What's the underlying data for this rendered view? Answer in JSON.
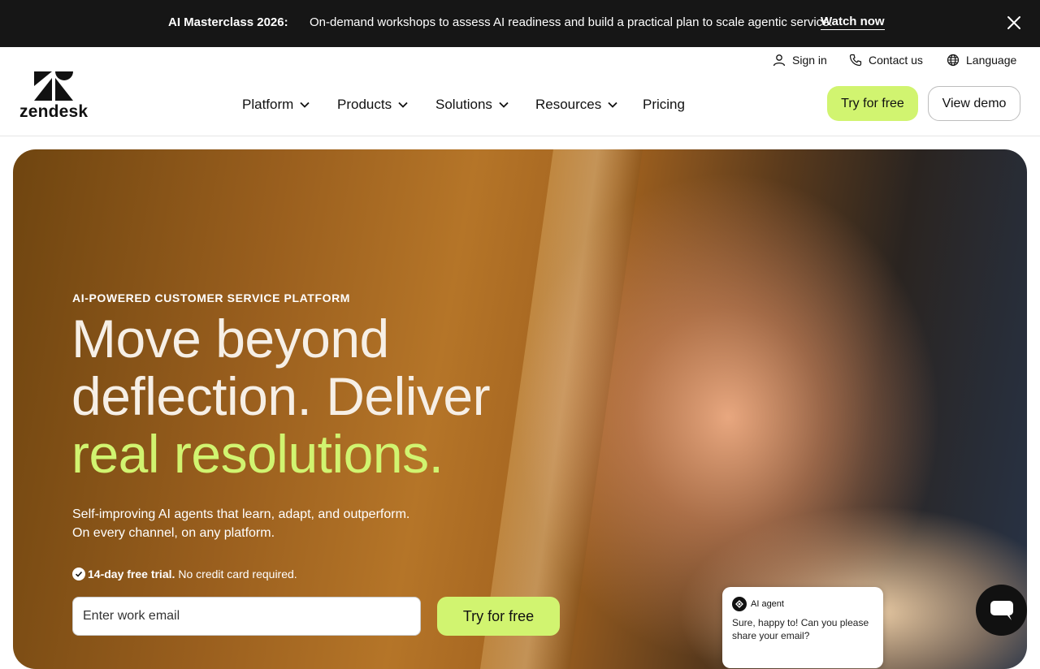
{
  "promo": {
    "title": "AI Masterclass 2026:",
    "text": "On-demand workshops to assess AI readiness and build a practical plan to scale agentic service.",
    "link": "Watch now"
  },
  "header": {
    "logo_text": "zendesk",
    "utility": {
      "sign_in": "Sign in",
      "contact": "Contact us",
      "language": "Language"
    },
    "nav": [
      "Platform",
      "Products",
      "Solutions",
      "Resources",
      "Pricing"
    ],
    "try_free": "Try for free",
    "view_demo": "View demo"
  },
  "hero": {
    "eyebrow": "AI-POWERED CUSTOMER SERVICE PLATFORM",
    "headline_line1": "Move beyond",
    "headline_line2": "deflection. Deliver",
    "headline_highlight": "real resolutions.",
    "sub_line1": "Self-improving AI agents that learn, adapt, and outperform.",
    "sub_line2": "On every channel, on any platform.",
    "trial_bold": "14-day free trial.",
    "trial_text": "No credit card required.",
    "email_placeholder": "Enter work email",
    "cta": "Try for free"
  },
  "chat": {
    "agent_label": "AI agent",
    "message": "Sure, happy to! Can you please share your email?"
  },
  "colors": {
    "accent": "#d1f470",
    "promo_bg": "#161616"
  }
}
